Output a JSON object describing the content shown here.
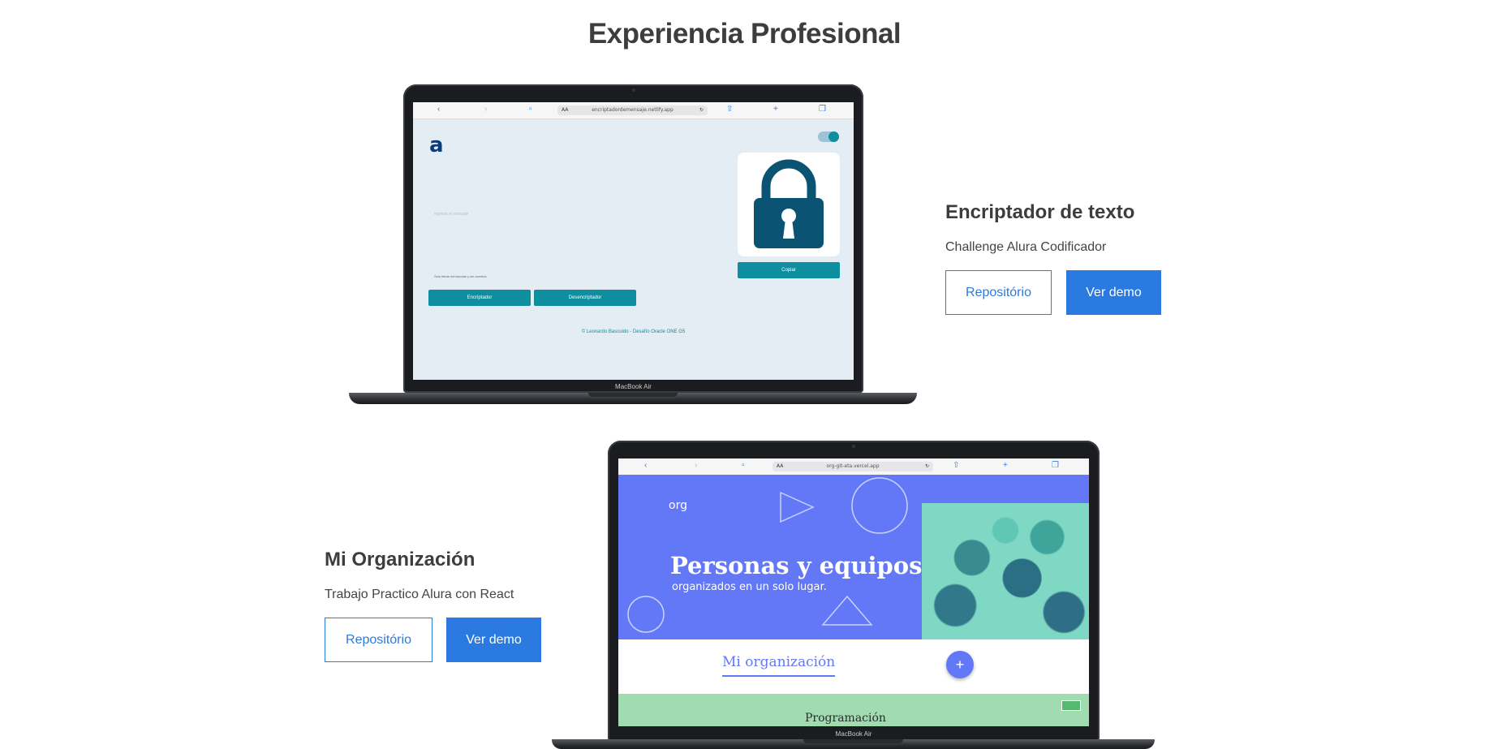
{
  "section": {
    "title": "Experiencia Profesional"
  },
  "projects": [
    {
      "title": "Encriptador de texto",
      "subtitle": "Challenge Alura Codificador",
      "repo_label": "Repositório",
      "demo_label": "Ver demo",
      "screen": {
        "url": "encriptadordemensaje.netlify.app",
        "logo": "a",
        "input_placeholder": "Ingrese el mensaje",
        "hint": "Solo letras minúsculas y sin acentos",
        "copy_label": "Copiar",
        "encrypt_label": "Encriptador",
        "decrypt_label": "Desencriptador",
        "footer": "© Leonardo Bascuido - Desafío Oracle ONE G5"
      },
      "device_label": "MacBook Air"
    },
    {
      "title": "Mi Organización",
      "subtitle": "Trabajo Practico Alura con React",
      "repo_label": "Repositório",
      "demo_label": "Ver demo",
      "screen": {
        "url": "org-git-eta.vercel.app",
        "logo": "org",
        "heading": "Personas y equipos",
        "subheading": "organizados en un solo lugar.",
        "org_title": "Mi organización",
        "add_symbol": "+",
        "green_text": "Programación"
      },
      "device_label": "MacBook Air"
    }
  ],
  "colors": {
    "accent": "#2a7ae2",
    "teal": "#0f8ea0",
    "org_purple": "#6278f7",
    "org_green": "#a0dcb0"
  }
}
